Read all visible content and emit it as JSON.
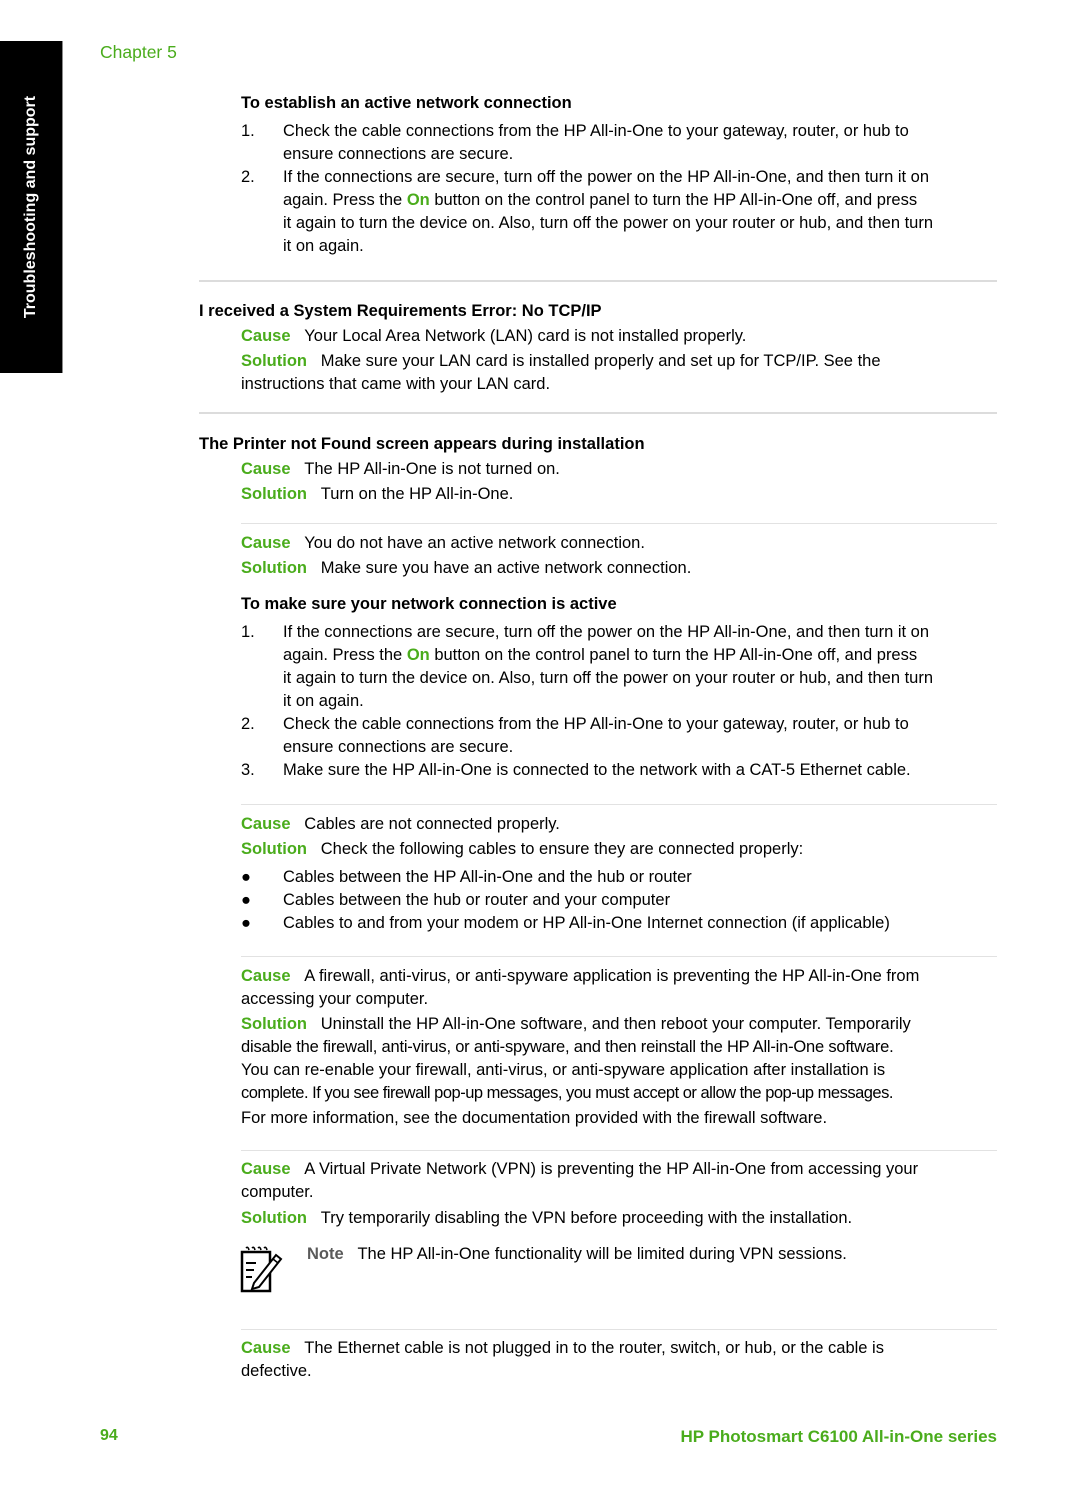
{
  "side_tab": "Troubleshooting and support",
  "chapter": "Chapter 5",
  "colors": {
    "accent": "#4aac1c",
    "text": "#000000",
    "separator": "#dcdcdc",
    "tab": "#000000"
  },
  "section1": {
    "heading": "To establish an active network connection",
    "steps": [
      {
        "n": "1.",
        "lines": [
          "Check the cable connections from the HP All-in-One to your gateway, router, or hub to",
          "ensure connections are secure."
        ]
      },
      {
        "n": "2.",
        "lines_pre": "If the connections are secure, turn off the power on the HP All-in-One, and then turn it on",
        "l2a": "again. Press the ",
        "on": "On",
        "l2b": " button on the control panel to turn the HP All-in-One off, and press",
        "l3": "it again to turn the device on. Also, turn off the power on your router or hub, and then turn",
        "l4": "it on again."
      }
    ]
  },
  "section2": {
    "heading": "I received a System Requirements Error: No TCP/IP",
    "cause_label": "Cause",
    "cause": "Your Local Area Network (LAN) card is not installed properly.",
    "solution_label": "Solution",
    "solution_l1": "Make sure your LAN card is installed properly and set up for TCP/IP. See the",
    "solution_l2": "instructions that came with your LAN card."
  },
  "section3": {
    "heading": "The Printer not Found screen appears during installation",
    "items": [
      {
        "cause_label": "Cause",
        "cause": "The HP All-in-One is not turned on.",
        "solution_label": "Solution",
        "solution": "Turn on the HP All-in-One."
      },
      {
        "cause_label": "Cause",
        "cause": "You do not have an active network connection.",
        "solution_label": "Solution",
        "solution": "Make sure you have an active network connection."
      }
    ],
    "subheading": "To make sure your network connection is active",
    "steps": {
      "s1_n": "1.",
      "s1_l1": "If the connections are secure, turn off the power on the HP All-in-One, and then turn it on",
      "s1_l2a": "again. Press the ",
      "s1_on": "On",
      "s1_l2b": " button on the control panel to turn the HP All-in-One off, and press",
      "s1_l3": "it again to turn the device on. Also, turn off the power on your router or hub, and then turn",
      "s1_l4": "it on again.",
      "s2_n": "2.",
      "s2_l1": "Check the cable connections from the HP All-in-One to your gateway, router, or hub to",
      "s2_l2": "ensure connections are secure.",
      "s3_n": "3.",
      "s3_l1": "Make sure the HP All-in-One is connected to the network with a CAT-5 Ethernet cable."
    },
    "cables": {
      "cause_label": "Cause",
      "cause": "Cables are not connected properly.",
      "solution_label": "Solution",
      "solution": "Check the following cables to ensure they are connected properly:",
      "bullets": [
        "Cables between the HP All-in-One and the hub or router",
        "Cables between the hub or router and your computer",
        "Cables to and from your modem or HP All-in-One Internet connection (if applicable)"
      ]
    },
    "firewall": {
      "cause_label": "Cause",
      "cause_l1": "A firewall, anti-virus, or anti-spyware application is preventing the HP All-in-One from",
      "cause_l2": "accessing your computer.",
      "solution_label": "Solution",
      "solution_l1": "Uninstall the HP All-in-One software, and then reboot your computer. Temporarily",
      "solution_l2": "disable the firewall, anti-virus, or anti-spyware, and then reinstall the HP All-in-One software.",
      "solution_l3": "You can re-enable your firewall, anti-virus, or anti-spyware application after installation is",
      "solution_l4": "complete. If you see firewall pop-up messages, you must accept or allow the pop-up messages.",
      "more": "For more information, see the documentation provided with the firewall software."
    },
    "vpn": {
      "cause_label": "Cause",
      "cause_l1": "A Virtual Private Network (VPN) is preventing the HP All-in-One from accessing your",
      "cause_l2": "computer.",
      "solution_label": "Solution",
      "solution": "Try temporarily disabling the VPN before proceeding with the installation.",
      "note_icon": "note-pencil-icon",
      "note_label": "Note",
      "note": "The HP All-in-One functionality will be limited during VPN sessions."
    },
    "ethernet": {
      "cause_label": "Cause",
      "cause_l1": "The Ethernet cable is not plugged in to the router, switch, or hub, or the cable is",
      "cause_l2": "defective."
    }
  },
  "footer": {
    "page": "94",
    "title": "HP Photosmart C6100 All-in-One series"
  }
}
